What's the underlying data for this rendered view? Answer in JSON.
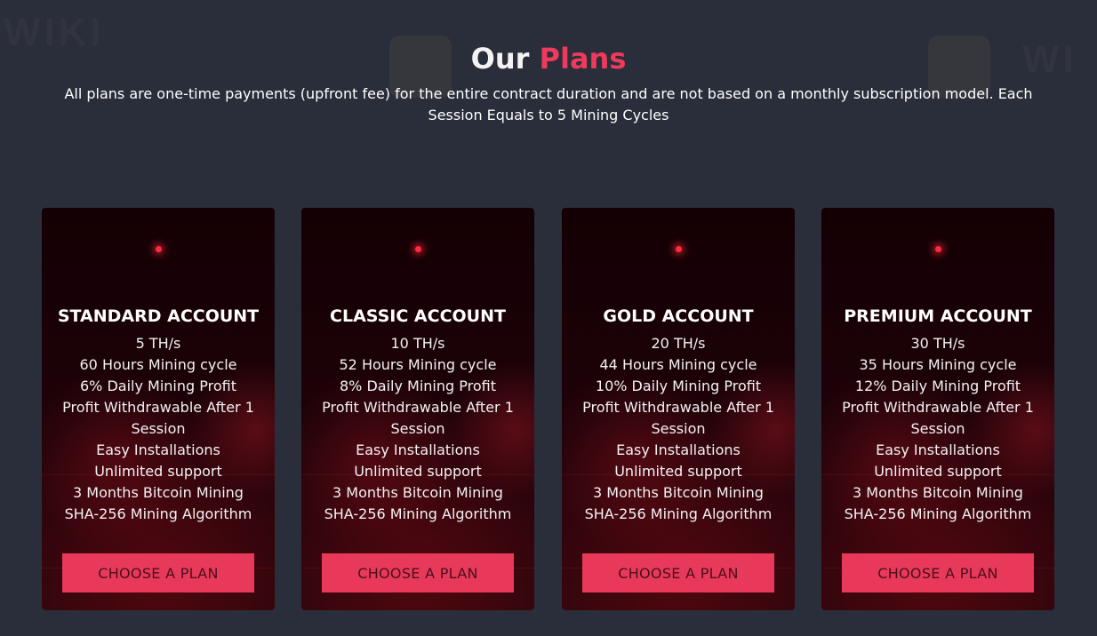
{
  "header": {
    "title_main": "Our",
    "title_accent": "Plans",
    "subtitle": "All plans are one-time payments (upfront fee) for the entire contract duration and are not based on a monthly subscription model. Each Session Equals to 5 Mining Cycles"
  },
  "colors": {
    "background": "#2a2d3a",
    "accent": "#ee3a5c",
    "button": "#e8395a",
    "button_text": "#4a0f1a",
    "card": "#1c0208"
  },
  "plans": [
    {
      "name": "STANDARD ACCOUNT",
      "features": [
        "5 TH/s",
        "60 Hours Mining cycle",
        "6% Daily Mining Profit",
        "Profit Withdrawable After 1",
        "Session",
        "Easy Installations",
        "Unlimited support",
        "3 Months Bitcoin Mining",
        "SHA-256 Mining Algorithm"
      ],
      "button": "CHOOSE A PLAN"
    },
    {
      "name": "CLASSIC ACCOUNT",
      "features": [
        "10 TH/s",
        "52 Hours Mining cycle",
        "8% Daily Mining Profit",
        "Profit Withdrawable After 1",
        "Session",
        "Easy Installations",
        "Unlimited support",
        "3 Months Bitcoin Mining",
        "SHA-256 Mining Algorithm"
      ],
      "button": "CHOOSE A PLAN"
    },
    {
      "name": "GOLD ACCOUNT",
      "features": [
        "20 TH/s",
        "44 Hours Mining cycle",
        "10% Daily Mining Profit",
        "Profit Withdrawable After 1",
        "Session",
        "Easy Installations",
        "Unlimited support",
        "3 Months Bitcoin Mining",
        "SHA-256 Mining Algorithm"
      ],
      "button": "CHOOSE A PLAN"
    },
    {
      "name": "PREMIUM ACCOUNT",
      "features": [
        "30 TH/s",
        "35 Hours Mining cycle",
        "12% Daily Mining Profit",
        "Profit Withdrawable After 1",
        "Session",
        "Easy Installations",
        "Unlimited support",
        "3 Months Bitcoin Mining",
        "SHA-256 Mining Algorithm"
      ],
      "button": "CHOOSE A PLAN"
    }
  ]
}
